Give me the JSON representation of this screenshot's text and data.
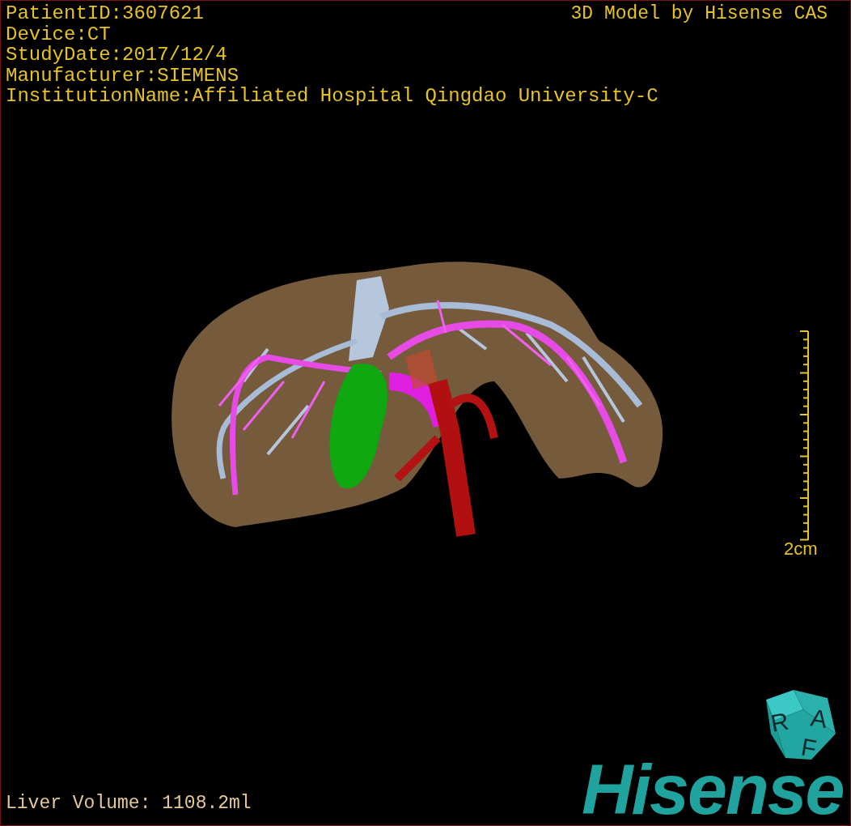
{
  "header_info": [
    "PatientID:3607621",
    "Device:CT",
    "StudyDate:2017/12/4",
    "Manufacturer:SIEMENS",
    "InstitutionName:Affiliated Hospital Qingdao University-C"
  ],
  "title": "3D Model by Hisense CAS",
  "scale_bar": {
    "label": "2cm"
  },
  "orientation_cube": {
    "labels": [
      "R",
      "A",
      "F"
    ]
  },
  "footer": {
    "liver_volume": "Liver Volume: 1108.2ml"
  },
  "logo": "Hisense"
}
